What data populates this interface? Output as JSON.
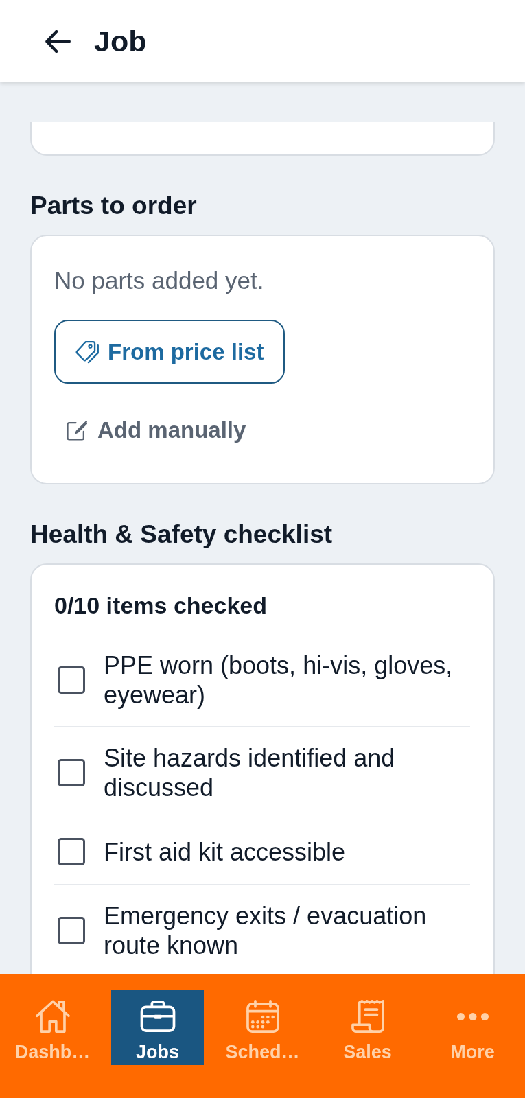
{
  "header": {
    "title": "Job"
  },
  "parts_section": {
    "heading": "Parts to order",
    "empty_text": "No parts added yet.",
    "actions": [
      {
        "label": "From price list",
        "kind": "outlined"
      },
      {
        "label": "Add manually",
        "kind": "text"
      }
    ]
  },
  "checklist_section": {
    "heading": "Health & Safety checklist",
    "summary": "0/10 items checked",
    "items": [
      {
        "label": "PPE worn (boots, hi-vis, gloves, eyewear)",
        "checked": false
      },
      {
        "label": "Site hazards identified and discussed",
        "checked": false
      },
      {
        "label": "First aid kit accessible",
        "checked": false
      },
      {
        "label": "Emergency exits / evacuation route known",
        "checked": false
      }
    ]
  },
  "bottom_nav": {
    "tabs": [
      {
        "label": "Dashb…",
        "selected": false
      },
      {
        "label": "Jobs",
        "selected": true
      },
      {
        "label": "Sched…",
        "selected": false
      },
      {
        "label": "Sales",
        "selected": false
      },
      {
        "label": "More",
        "selected": false
      }
    ]
  }
}
